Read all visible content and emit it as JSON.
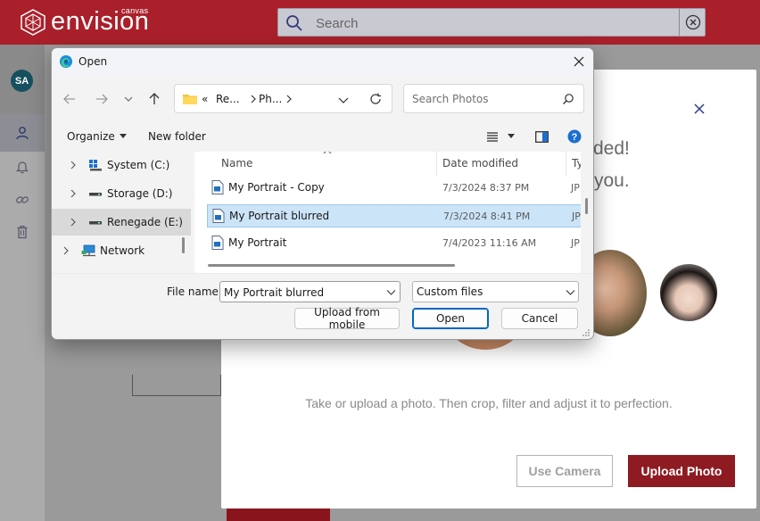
{
  "app": {
    "logo_text": "envision",
    "logo_sub": "canvas",
    "search_placeholder": "Search",
    "user_initials": "SA",
    "modal": {
      "text_line1": "ded!",
      "text_line2": "you.",
      "description": "Take or upload a photo. Then crop, filter and adjust it to perfection.",
      "use_camera_label": "Use Camera",
      "upload_photo_label": "Upload Photo"
    },
    "brand_color": "#a9202a"
  },
  "dialog": {
    "title": "Open",
    "address": {
      "breadcrumb_prefix": "«",
      "crumbs": [
        "Re...",
        "Ph..."
      ]
    },
    "search_placeholder": "Search Photos",
    "toolbar": {
      "organize": "Organize",
      "new_folder": "New folder"
    },
    "tree": [
      {
        "label": "System (C:)",
        "icon": "windows-drive-icon"
      },
      {
        "label": "Storage (D:)",
        "icon": "drive-icon"
      },
      {
        "label": "Renegade (E:)",
        "icon": "drive-icon",
        "selected": true
      },
      {
        "label": "Network",
        "icon": "network-icon"
      }
    ],
    "columns": [
      "Name",
      "Date modified",
      "Ty"
    ],
    "files": [
      {
        "name": "My Portrait - Copy",
        "date": "7/3/2024 8:37 PM",
        "type": "JP"
      },
      {
        "name": "My Portrait blurred",
        "date": "7/3/2024 8:41 PM",
        "type": "JP",
        "selected": true
      },
      {
        "name": "My Portrait",
        "date": "7/4/2023 11:16 AM",
        "type": "JP"
      }
    ],
    "file_name_label": "File name:",
    "file_name_value": "My Portrait blurred",
    "file_type_value": "Custom files",
    "buttons": {
      "upload_mobile": "Upload from mobile",
      "open": "Open",
      "cancel": "Cancel"
    }
  }
}
